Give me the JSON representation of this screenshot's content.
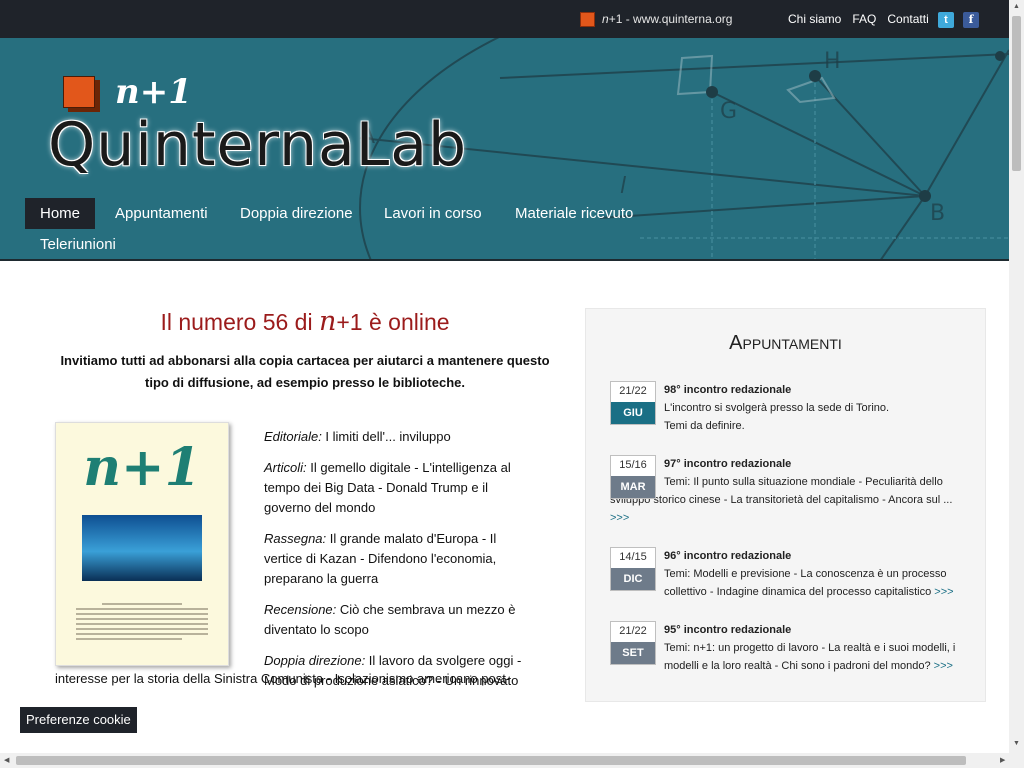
{
  "topbar": {
    "brand_n": "n",
    "brand_rest": "+1 - www.quinterna.org",
    "links": [
      "Chi siamo",
      "FAQ",
      "Contatti"
    ]
  },
  "logo": {
    "n1": "n+1",
    "name": "QuinternaLab"
  },
  "nav": [
    "Home",
    "Appuntamenti",
    "Doppia direzione",
    "Lavori in corso",
    "Materiale ricevuto",
    "Teleriunioni"
  ],
  "main": {
    "title_pre": "Il numero 56 di ",
    "title_n": "n",
    "title_post": "+1 è online",
    "intro": "Invitiamo tutti ad abbonarsi alla copia cartacea per aiutarci a mantenere questo tipo di diffusione, ad esempio presso le biblioteche.",
    "cover_title": "n+1",
    "items": [
      {
        "label": "Editoriale:",
        "text": " I limiti dell'... inviluppo"
      },
      {
        "label": "Articoli:",
        "text": " Il gemello digitale - L'intelligenza al tempo dei Big Data - Donald Trump e il governo del mondo"
      },
      {
        "label": "Rassegna:",
        "text": " Il grande malato d'Europa - Il vertice di Kazan - Difendono l'economia, preparano la guerra"
      },
      {
        "label": "Recensione:",
        "text": " Ciò che sembrava un mezzo è diventato lo scopo"
      },
      {
        "label": "Doppia direzione:",
        "text": " Il lavoro da svolgere oggi - Modo di produzione asiatico? - Un rinnovato"
      }
    ],
    "tail": "interesse per la storia della Sinistra Comunista - Isolazionismo americano post-"
  },
  "sidebar": {
    "title": "Appuntamenti",
    "events": [
      {
        "day": "21/22",
        "month": "GIU",
        "month_color": "#1a6f85",
        "title": "98° incontro redazionale",
        "lines": [
          "L'incontro si svolgerà presso la sede di Torino.",
          "Temi da definire."
        ],
        "more": ""
      },
      {
        "day": "15/16",
        "month": "MAR",
        "month_color": "#6e7b8a",
        "title": "97° incontro redazionale",
        "lines": [
          "Temi: Il punto sulla situazione mondiale - Peculiarità dello sviluppo storico cinese - La transitorietà del capitalismo - Ancora sul ..."
        ],
        "more": ">>>"
      },
      {
        "day": "14/15",
        "month": "DIC",
        "month_color": "#6e7b8a",
        "title": "96° incontro redazionale",
        "lines": [
          "Temi: Modelli e previsione - La conoscenza è un processo collettivo - Indagine dinamica del processo capitalistico"
        ],
        "more": ">>>"
      },
      {
        "day": "21/22",
        "month": "SET",
        "month_color": "#6e7b8a",
        "title": "95° incontro redazionale",
        "lines": [
          "Temi: n+1: un progetto di lavoro - La realtà e i suoi modelli, i modelli e la loro realtà - Chi sono i padroni del mondo?"
        ],
        "more": ">>>"
      }
    ]
  },
  "cookie": "Preferenze cookie"
}
